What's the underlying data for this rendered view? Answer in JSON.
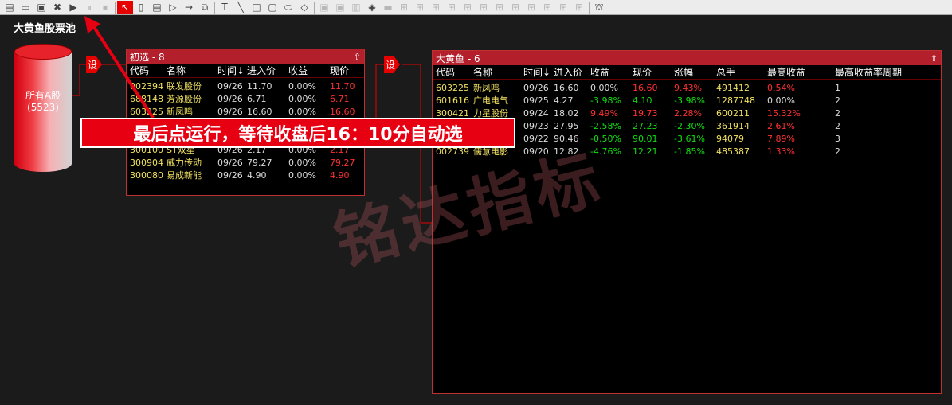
{
  "toolbar": {
    "icons": [
      "new-file",
      "open-folder",
      "save",
      "delete",
      "run",
      "pause",
      "stop",
      "select",
      "rounded-rect",
      "document",
      "play",
      "arrow",
      "copy-window",
      "text",
      "line",
      "rectangle",
      "rounded-rectangle",
      "ellipse",
      "diamond",
      "align-1",
      "align-2",
      "align-3",
      "align-4",
      "align-5",
      "align-6",
      "align-7",
      "align-8",
      "align-9",
      "align-10",
      "align-11",
      "align-12",
      "align-13",
      "align-14",
      "chart"
    ]
  },
  "pool_title": "大黄鱼股票池",
  "cylinder": {
    "line1": "所有A股",
    "line2": "(5523)"
  },
  "set_label": "设",
  "panel1": {
    "title": "初选 - 8",
    "headers": [
      "代码",
      "名称",
      "时间↓",
      "进入价",
      "收益",
      "现价"
    ],
    "rows": [
      [
        "002394",
        "联发股份",
        "09/26",
        "11.70",
        "0.00%",
        "11.70"
      ],
      [
        "688148",
        "芳源股份",
        "09/26",
        "6.71",
        "0.00%",
        "6.71"
      ],
      [
        "603225",
        "新凤鸣",
        "09/26",
        "16.60",
        "0.00%",
        "16.60"
      ],
      [
        "",
        "",
        "",
        "",
        "",
        ""
      ],
      [
        "300",
        "",
        "",
        "",
        "",
        ""
      ],
      [
        "300100",
        "ST双星",
        "09/26",
        "2.17",
        "0.00%",
        "2.17"
      ],
      [
        "300904",
        "威力传动",
        "09/26",
        "79.27",
        "0.00%",
        "79.27"
      ],
      [
        "300080",
        "易成新能",
        "09/26",
        "4.90",
        "0.00%",
        "4.90"
      ]
    ]
  },
  "panel2": {
    "title": "大黄鱼 - 6",
    "headers": [
      "代码",
      "名称",
      "时间↓",
      "进入价",
      "收益",
      "现价",
      "涨幅",
      "总手",
      "最高收益",
      "最高收益率周期"
    ],
    "rows": [
      [
        "603225",
        "新凤鸣",
        "09/26",
        "16.60",
        "0.00%",
        "16.60",
        "9.43%",
        "491412",
        "0.54%",
        "1"
      ],
      [
        "601616",
        "广电电气",
        "09/25",
        "4.27",
        "-3.98%",
        "4.10",
        "-3.98%",
        "1287748",
        "0.00%",
        "2"
      ],
      [
        "300421",
        "力星股份",
        "09/24",
        "18.02",
        "9.49%",
        "19.73",
        "2.28%",
        "600211",
        "15.32%",
        "2"
      ],
      [
        "",
        "",
        "09/23",
        "27.95",
        "-2.58%",
        "27.23",
        "-2.30%",
        "361914",
        "2.61%",
        "2"
      ],
      [
        "",
        "",
        "09/22",
        "90.46",
        "-0.50%",
        "90.01",
        "-3.61%",
        "94079",
        "7.89%",
        "3"
      ],
      [
        "002739",
        "儒意电影",
        "09/20",
        "12.82",
        "-4.76%",
        "12.21",
        "-1.85%",
        "485387",
        "1.33%",
        "2"
      ]
    ]
  },
  "banner": "最后点运行，等待收盘后16：10分自动选",
  "watermark": "铭达指标",
  "colors": {
    "accent": "#e60012",
    "up": "#ff3030",
    "down": "#10e010",
    "code": "#f0e060"
  }
}
